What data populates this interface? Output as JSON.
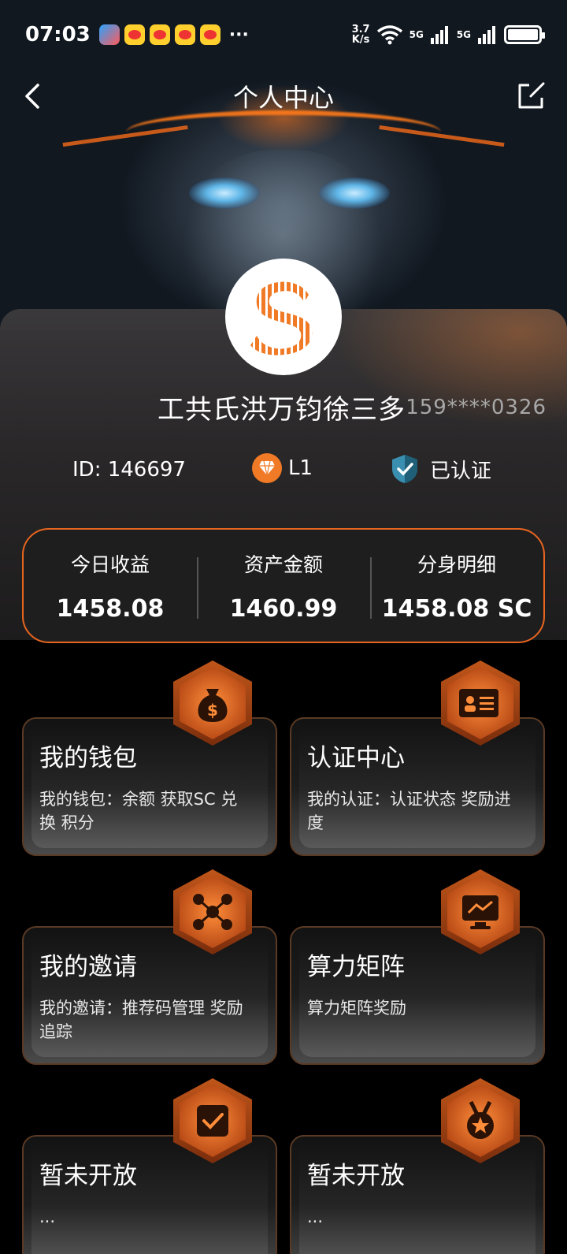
{
  "status_bar": {
    "time": "07:03",
    "dots": "···",
    "speed_top": "3.7",
    "speed_bottom": "K/s",
    "net1": "5G",
    "net2": "5G"
  },
  "nav": {
    "title": "个人中心"
  },
  "profile": {
    "name": "工共氏洪万钧徐三多",
    "phone": "159****0326",
    "id_text": "ID: 146697",
    "level": "L1",
    "verified": "已认证"
  },
  "stats": [
    {
      "label": "今日收益",
      "value": "1458.08"
    },
    {
      "label": "资产金额",
      "value": "1460.99"
    },
    {
      "label": "分身明细",
      "value": "1458.08 SC"
    }
  ],
  "cards": [
    {
      "title": "我的钱包",
      "desc": "我的钱包：余额 获取SC 兑换 积分",
      "icon": "money-bag-icon"
    },
    {
      "title": "认证中心",
      "desc": "我的认证：认证状态 奖励进度",
      "icon": "id-card-icon"
    },
    {
      "title": "我的邀请",
      "desc": "我的邀请：推荐码管理 奖励追踪",
      "icon": "network-icon"
    },
    {
      "title": "算力矩阵",
      "desc": "算力矩阵奖励",
      "icon": "monitor-chart-icon"
    },
    {
      "title": "暂未开放",
      "desc": "...",
      "icon": "checkbox-icon"
    },
    {
      "title": "暂未开放",
      "desc": "...",
      "icon": "medal-icon"
    }
  ],
  "colors": {
    "accent": "#f07a25",
    "background": "#000000",
    "card_border": "#e8651f"
  }
}
